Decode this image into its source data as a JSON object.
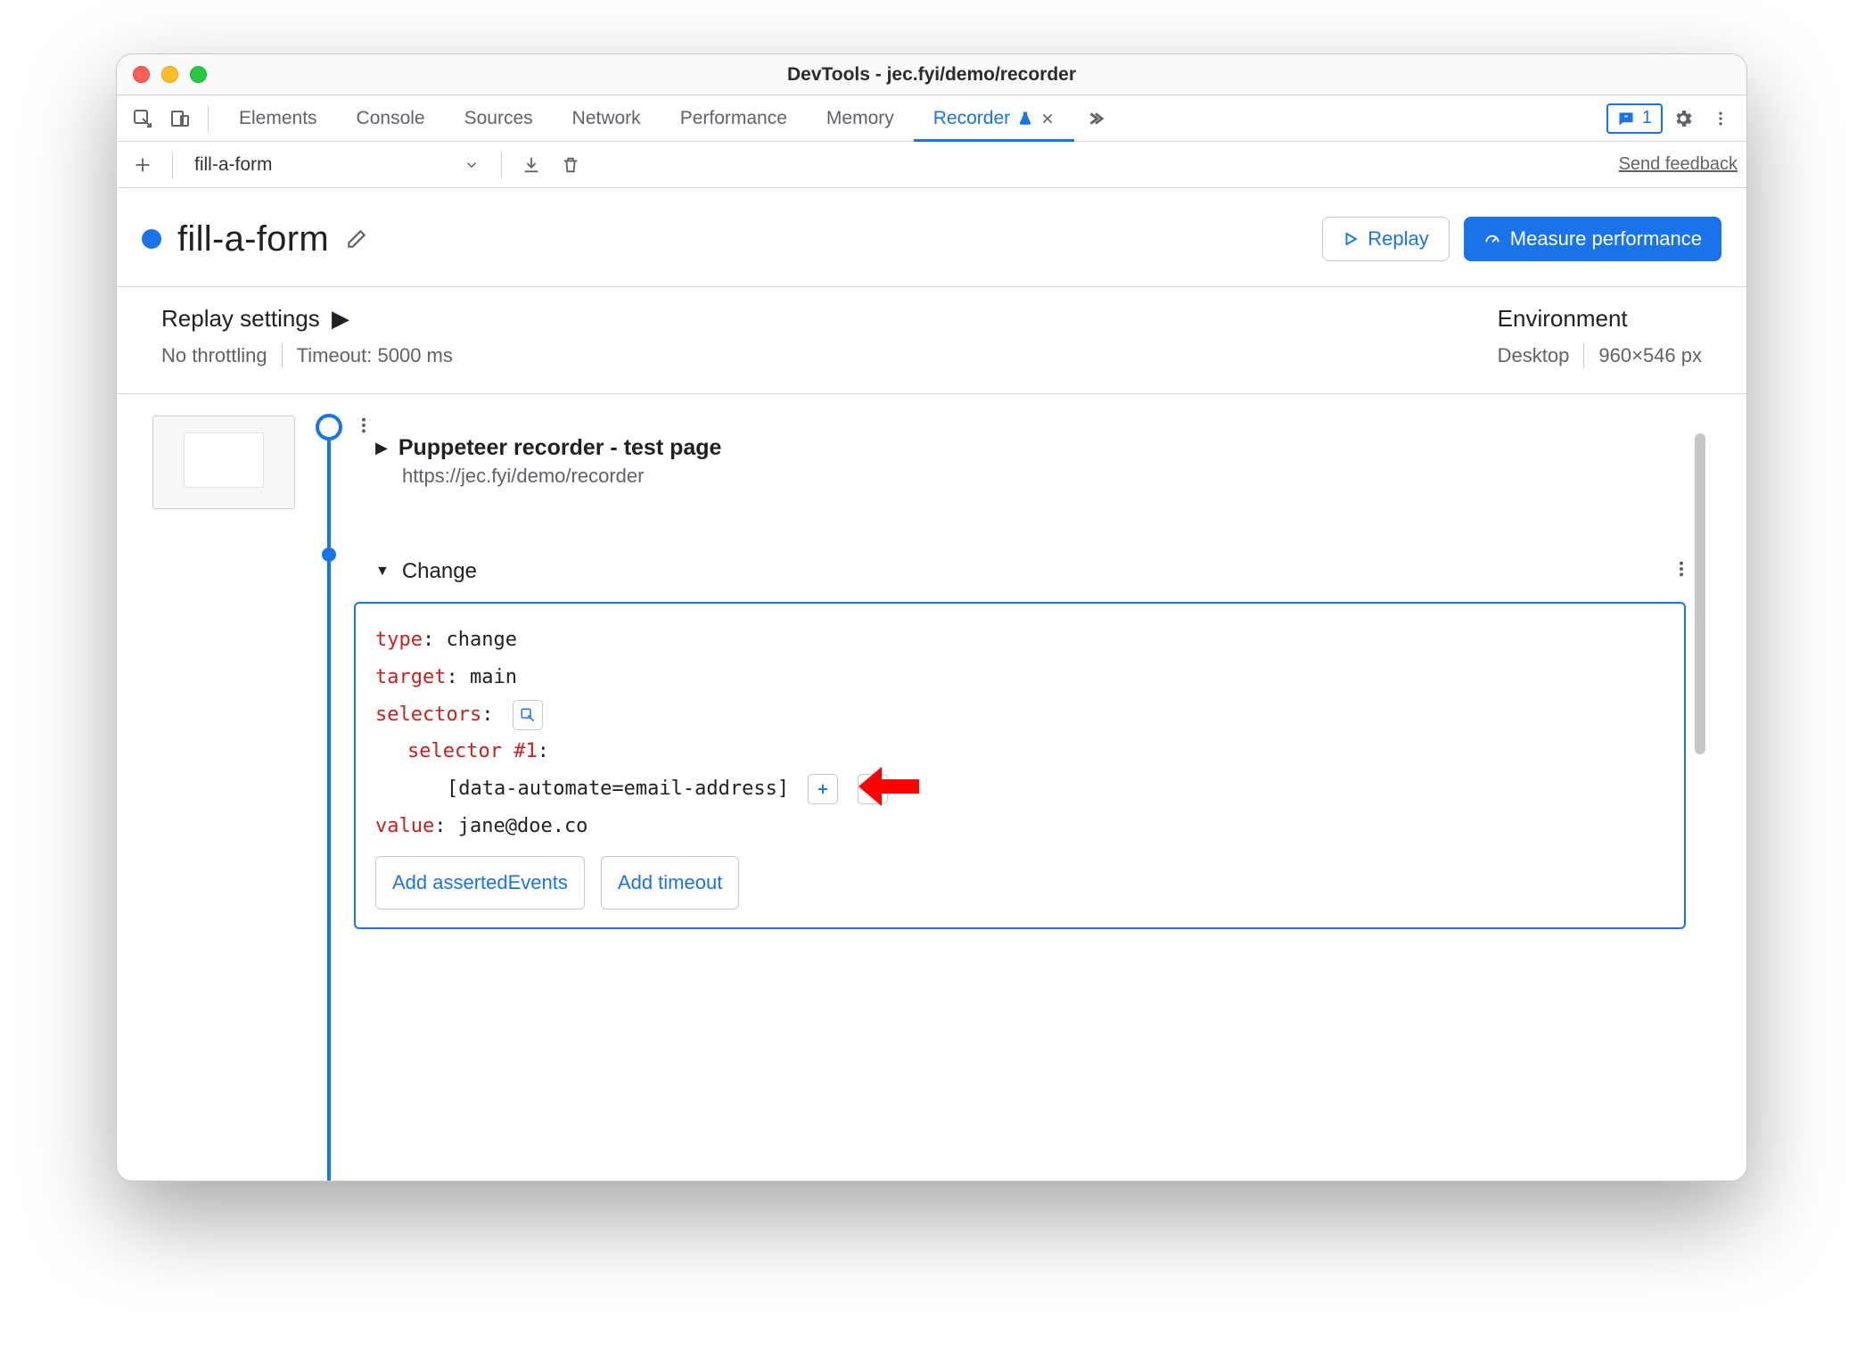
{
  "window": {
    "title": "DevTools - jec.fyi/demo/recorder"
  },
  "tabs": {
    "items": [
      "Elements",
      "Console",
      "Sources",
      "Network",
      "Performance",
      "Memory"
    ],
    "active": "Recorder"
  },
  "issues": {
    "count": "1"
  },
  "toolbar": {
    "recording_name": "fill-a-form",
    "feedback": "Send feedback"
  },
  "heading": {
    "title": "fill-a-form",
    "replay_label": "Replay",
    "measure_label": "Measure performance"
  },
  "settings": {
    "replay_title": "Replay settings",
    "throttling": "No throttling",
    "timeout": "Timeout: 5000 ms",
    "env_title": "Environment",
    "device": "Desktop",
    "viewport": "960×546 px"
  },
  "steps": {
    "first": {
      "title": "Puppeteer recorder - test page",
      "url": "https://jec.fyi/demo/recorder"
    },
    "change": {
      "label": "Change",
      "code": {
        "type_k": "type",
        "type_v": "change",
        "target_k": "target",
        "target_v": "main",
        "selectors_k": "selectors",
        "sel1_k": "selector #1",
        "sel1_v": "[data-automate=email-address]",
        "value_k": "value",
        "value_v": "jane@doe.co"
      },
      "add_asserted": "Add assertedEvents",
      "add_timeout": "Add timeout"
    }
  }
}
